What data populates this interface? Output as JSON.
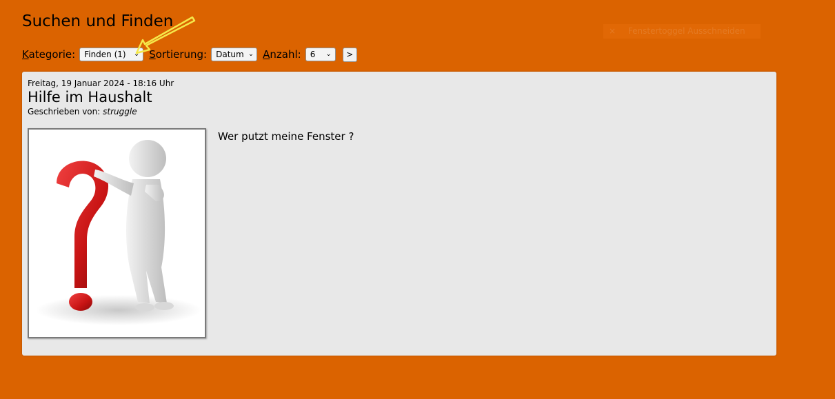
{
  "page": {
    "title": "Suchen und Finden",
    "faded_overlay_text": "Fenstertoggel Ausschneiden",
    "faded_overlay_close": "×"
  },
  "filters": {
    "kategorie_label_first": "K",
    "kategorie_label_rest": "ategorie:",
    "kategorie_value": "Finden (1)",
    "sortierung_label_first": "S",
    "sortierung_label_rest": "ortierung:",
    "sortierung_value": "Datum",
    "anzahl_label_first": "A",
    "anzahl_label_rest": "nzahl:",
    "anzahl_value": "6",
    "go_label": ">"
  },
  "post": {
    "date": "Freitag, 19 Januar 2024 - 18:16 Uhr",
    "title": "Hilfe im Haushalt",
    "author_prefix": "Geschrieben von:",
    "author": "struggle",
    "text": "Wer putzt meine Fenster ?"
  },
  "icons": {
    "dropdown": "chevron-down-icon",
    "arrow": "annotation-arrow-icon"
  },
  "colors": {
    "background": "#db6300",
    "card": "#e8e8e8",
    "arrow": "#f5e84a"
  }
}
